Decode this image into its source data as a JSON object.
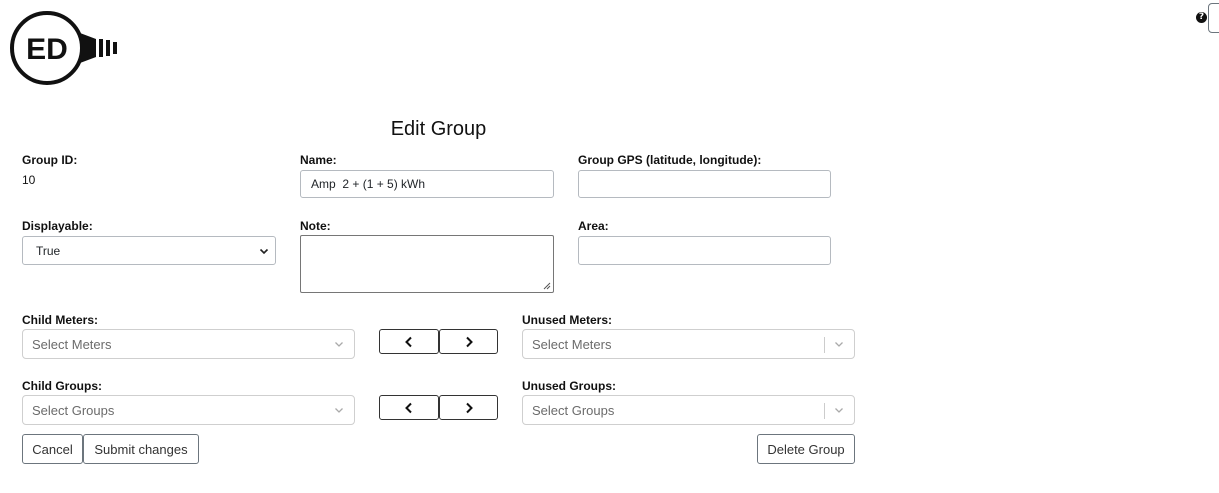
{
  "header": {
    "logo_text": "ED",
    "help_icon": "question-circle-icon"
  },
  "page": {
    "title": "Edit Group"
  },
  "fields": {
    "group_id_label": "Group ID:",
    "group_id_value": "10",
    "name_label": "Name:",
    "name_value": "Amp  2 + (1 + 5) kWh",
    "gps_label": "Group GPS (latitude, longitude):",
    "gps_value": "",
    "displayable_label": "Displayable:",
    "displayable_value": "True",
    "note_label": "Note:",
    "note_value": "",
    "area_label": "Area:",
    "area_value": ""
  },
  "meters": {
    "child_label": "Child Meters:",
    "child_placeholder": "Select Meters",
    "unused_label": "Unused Meters:",
    "unused_placeholder": "Select Meters"
  },
  "groups": {
    "child_label": "Child Groups:",
    "child_placeholder": "Select Groups",
    "unused_label": "Unused Groups:",
    "unused_placeholder": "Select Groups"
  },
  "actions": {
    "cancel_label": "Cancel",
    "submit_label": "Submit changes",
    "delete_label": "Delete Group"
  },
  "colors": {
    "text": "#111111",
    "border": "#b5bac0",
    "background": "#ffffff"
  }
}
